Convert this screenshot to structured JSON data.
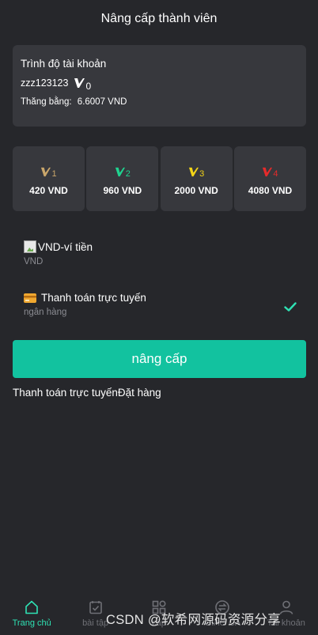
{
  "header": {
    "title": "Nâng cấp thành viên"
  },
  "account": {
    "title": "Trình độ tài khoản",
    "username": "zzz123123",
    "level": "0",
    "balance_label": "Thăng bằng:",
    "balance_value": "6.6007 VND"
  },
  "tiers": [
    {
      "level": "1",
      "price": "420 VND",
      "color": "#c9a66b"
    },
    {
      "level": "2",
      "price": "960 VND",
      "color": "#1fd38f"
    },
    {
      "level": "3",
      "price": "2000 VND",
      "color": "#f2d317"
    },
    {
      "level": "4",
      "price": "4080 VND",
      "color": "#e52b2b"
    }
  ],
  "payment": [
    {
      "title": "VND-ví tiền",
      "sub": "VND",
      "icon": "broken-image-icon",
      "selected": false
    },
    {
      "title": "Thanh toán trực tuyến",
      "sub": "ngân hàng",
      "icon": "card-icon",
      "selected": true
    }
  ],
  "upgrade_button": "nâng cấp",
  "links": {
    "online_payment": "Thanh toán trực tuyến",
    "order": "Đặt hàng"
  },
  "nav": [
    {
      "label": "Trang chủ",
      "icon": "home-icon",
      "active": true
    },
    {
      "label": "bài tập",
      "icon": "task-icon",
      "active": false
    },
    {
      "label": "cấp",
      "icon": "grid-icon",
      "active": false
    },
    {
      "label": "GIAO CA",
      "icon": "exchange-icon",
      "active": false
    },
    {
      "label": "Tài khoản",
      "icon": "user-icon",
      "active": false
    }
  ],
  "watermark": "CSDN @软希网源码资源分享",
  "colors": {
    "background": "#26272b",
    "card": "#37383d",
    "accent": "#12c29f",
    "check": "#2fe2b4"
  }
}
